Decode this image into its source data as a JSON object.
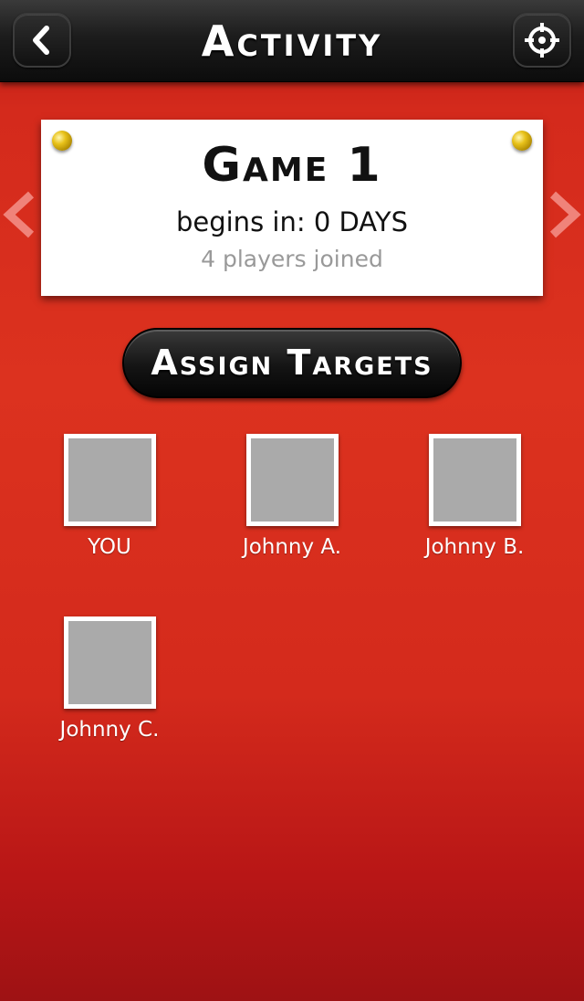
{
  "header": {
    "title": "Activity",
    "back_icon": "chevron-left-icon",
    "target_icon": "crosshair-icon"
  },
  "game_card": {
    "name": "Game 1",
    "begins_label": "begins in: 0 DAYS",
    "players_joined": "4 players joined"
  },
  "assign_button": {
    "label": "Assign Targets"
  },
  "players": [
    {
      "name": "YOU"
    },
    {
      "name": "Johnny A."
    },
    {
      "name": "Johnny B."
    },
    {
      "name": "Johnny C."
    }
  ],
  "colors": {
    "background": "#d42a1c",
    "topbar": "#111111",
    "pin": "#e8c21a",
    "avatar_placeholder": "#aaaaaa"
  }
}
